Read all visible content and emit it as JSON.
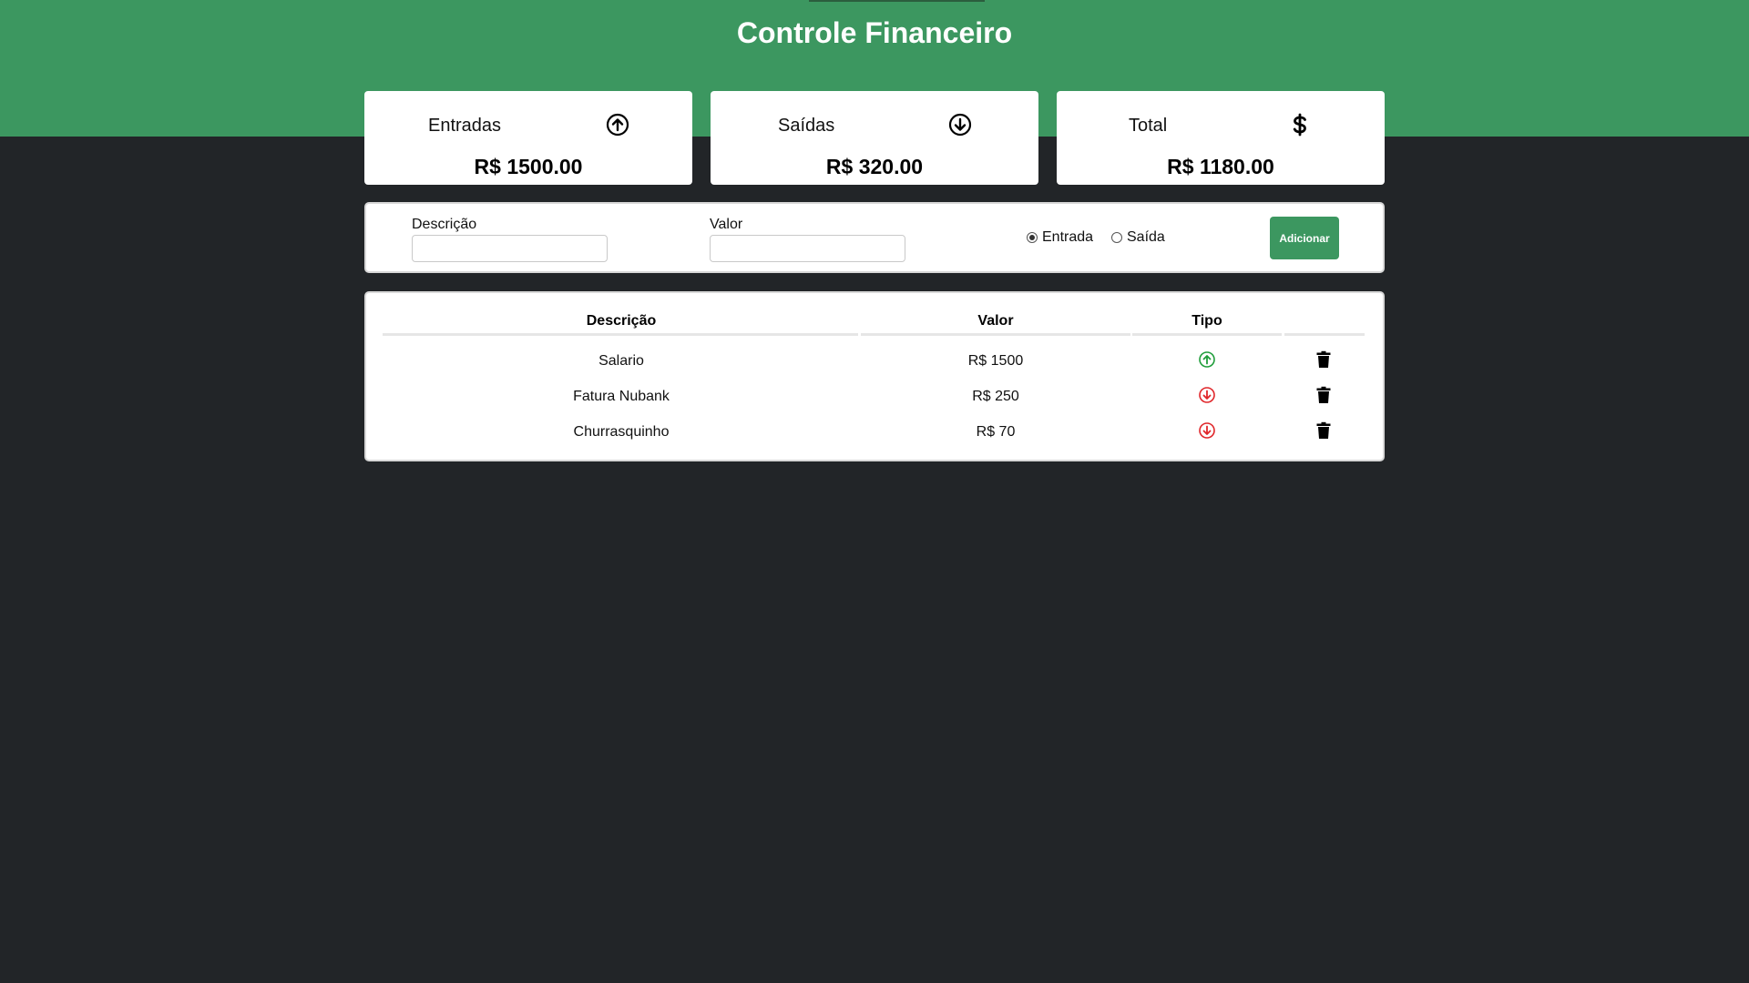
{
  "header": {
    "title": "Controle Financeiro",
    "color": "#3c9760"
  },
  "summary": {
    "entradas": {
      "label": "Entradas",
      "value": "R$ 1500.00",
      "icon": "arrow-up-circle-icon"
    },
    "saidas": {
      "label": "Saídas",
      "value": "R$ 320.00",
      "icon": "arrow-down-circle-icon"
    },
    "total": {
      "label": "Total",
      "value": "R$ 1180.00",
      "icon": "dollar-icon"
    }
  },
  "form": {
    "descricao_label": "Descrição",
    "descricao_value": "",
    "valor_label": "Valor",
    "valor_value": "",
    "radio_entrada": "Entrada",
    "radio_saida": "Saída",
    "selected": "Entrada",
    "button_label": "Adicionar"
  },
  "table": {
    "headers": [
      "Descrição",
      "Valor",
      "Tipo"
    ],
    "rows": [
      {
        "descricao": "Salario",
        "valor": "R$ 1500",
        "tipo": "entrada"
      },
      {
        "descricao": "Fatura Nubank",
        "valor": "R$ 250",
        "tipo": "saida"
      },
      {
        "descricao": "Churrasquinho",
        "valor": "R$ 70",
        "tipo": "saida"
      }
    ]
  },
  "colors": {
    "accent": "#3c9760",
    "background": "#222528",
    "entrada": "#1f9d3a",
    "saida": "#e0262a"
  }
}
